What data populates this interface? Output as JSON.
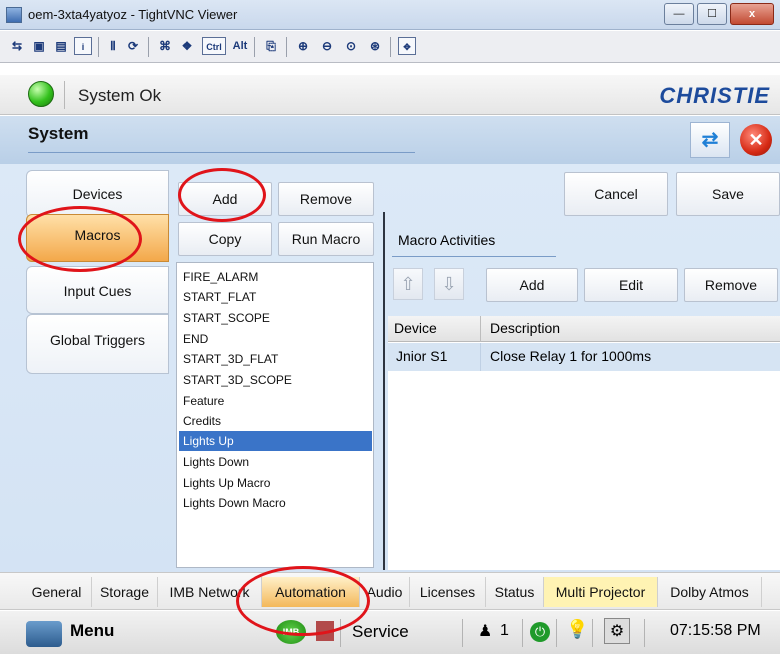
{
  "window": {
    "title": "oem-3xta4yatyoz - TightVNC Viewer",
    "minimize": "—",
    "maximize": "☐",
    "close": "x"
  },
  "vnc_toolbar": {
    "ctrl_label": "Ctrl",
    "alt_label": "Alt"
  },
  "status": {
    "text": "System Ok",
    "brand": "CHRISTIE",
    "status_color": "#33c11d"
  },
  "page": {
    "title": "System"
  },
  "left_tabs": [
    "Devices",
    "Macros",
    "Input Cues",
    "Global Triggers"
  ],
  "macro_buttons": {
    "add": "Add",
    "remove": "Remove",
    "copy": "Copy",
    "run": "Run Macro"
  },
  "top_actions": {
    "cancel": "Cancel",
    "save": "Save"
  },
  "macros": [
    "FIRE_ALARM",
    "START_FLAT",
    "START_SCOPE",
    "END",
    "START_3D_FLAT",
    "START_3D_SCOPE",
    "Feature",
    "Credits",
    "Lights Up",
    "Lights Down",
    "Lights Up Macro",
    "Lights Down Macro"
  ],
  "selected_macro": "Lights Up",
  "activities": {
    "title": "Macro Activities",
    "add": "Add",
    "edit": "Edit",
    "remove": "Remove",
    "columns": [
      "Device",
      "Description"
    ],
    "rows": [
      {
        "device": "Jnior S1",
        "description": "Close Relay 1 for 1000ms"
      }
    ]
  },
  "bottom_tabs": [
    "General",
    "Storage",
    "IMB Network",
    "Automation",
    "Audio",
    "Licenses",
    "Status",
    "Multi Projector",
    "Dolby Atmos"
  ],
  "footer": {
    "menu": "Menu",
    "imb": "IMB",
    "service": "Service",
    "count": "1",
    "time": "07:15:58 PM"
  },
  "colors": {
    "accent_blue": "#1d4b9c",
    "selection": "#3a74c8",
    "annotation_red": "#e0141a",
    "active_tab": "#f3a84a"
  }
}
